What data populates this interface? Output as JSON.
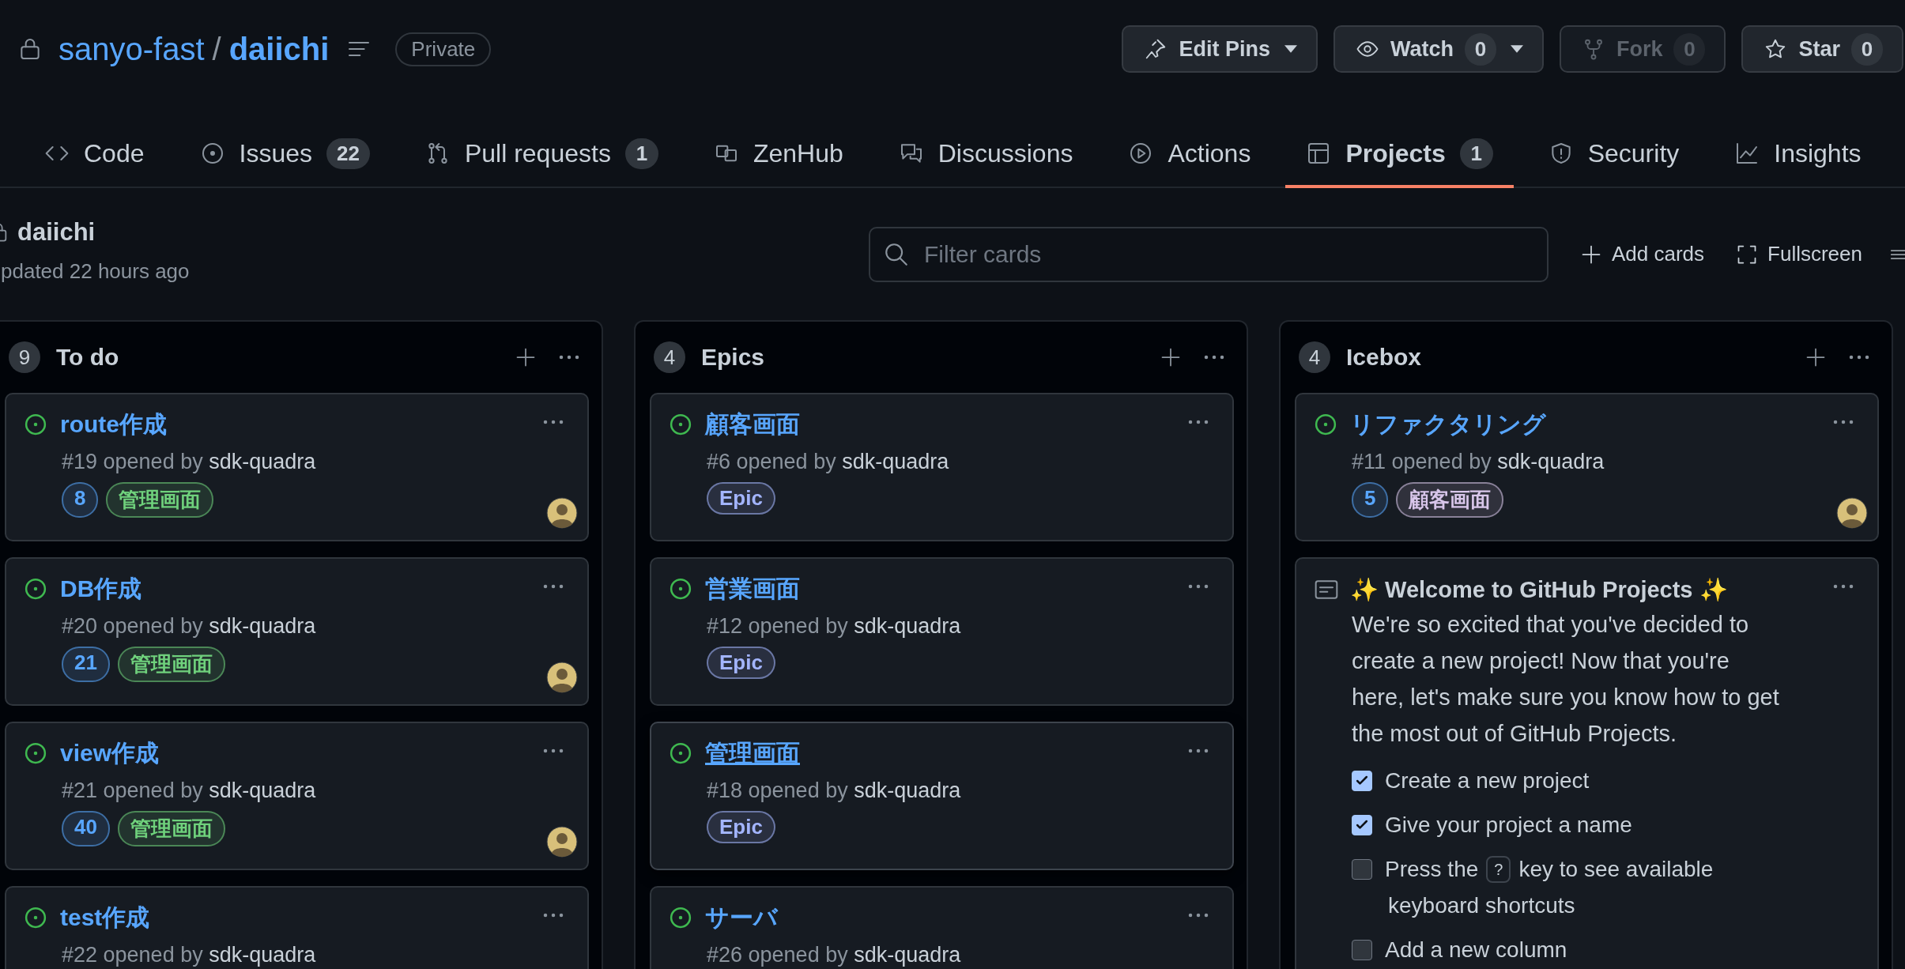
{
  "repo": {
    "owner": "sanyo-fast",
    "separator": "/",
    "name": "daiichi",
    "visibility": "Private"
  },
  "repo_actions": [
    {
      "kind": "pin",
      "label": "Edit Pins",
      "dropdown": true,
      "disabled": false
    },
    {
      "kind": "eye",
      "label": "Watch",
      "count": "0",
      "dropdown": true,
      "disabled": false
    },
    {
      "kind": "fork",
      "label": "Fork",
      "count": "0",
      "dropdown": false,
      "disabled": true
    },
    {
      "kind": "star",
      "label": "Star",
      "count": "0",
      "dropdown": false,
      "disabled": false
    }
  ],
  "tabs": [
    {
      "kind": "code",
      "label": "Code",
      "selected": false
    },
    {
      "kind": "issues",
      "label": "Issues",
      "count": "22",
      "selected": false
    },
    {
      "kind": "pulls",
      "label": "Pull requests",
      "count": "1",
      "selected": false
    },
    {
      "kind": "zenhub",
      "label": "ZenHub",
      "selected": false
    },
    {
      "kind": "discussions",
      "label": "Discussions",
      "selected": false
    },
    {
      "kind": "actions",
      "label": "Actions",
      "selected": false
    },
    {
      "kind": "projects",
      "label": "Projects",
      "count": "1",
      "selected": true
    },
    {
      "kind": "security",
      "label": "Security",
      "selected": false
    },
    {
      "kind": "insights",
      "label": "Insights",
      "selected": false
    }
  ],
  "project": {
    "title": "daiichi",
    "updated": "pdated 22 hours ago"
  },
  "filter": {
    "placeholder": "Filter cards"
  },
  "toolbar": [
    {
      "kind": "add",
      "label": "Add cards"
    },
    {
      "kind": "fullscreen",
      "label": "Fullscreen"
    },
    {
      "kind": "menu"
    }
  ],
  "columns": [
    {
      "count": "9",
      "name": "To do",
      "cards": [
        {
          "kind": "issue",
          "title": "route作成",
          "number": "#19",
          "opened": "opened by",
          "author": "sdk-quadra",
          "hovered": false,
          "assigned": true,
          "labels": [
            {
              "text": "8",
              "color": "#58a6ff"
            },
            {
              "text": "管理画面",
              "color": "#6fd17c"
            }
          ]
        },
        {
          "kind": "issue",
          "title": "DB作成",
          "number": "#20",
          "opened": "opened by",
          "author": "sdk-quadra",
          "hovered": false,
          "assigned": true,
          "labels": [
            {
              "text": "21",
              "color": "#58a6ff"
            },
            {
              "text": "管理画面",
              "color": "#6fd17c"
            }
          ]
        },
        {
          "kind": "issue",
          "title": "view作成",
          "number": "#21",
          "opened": "opened by",
          "author": "sdk-quadra",
          "hovered": false,
          "assigned": true,
          "labels": [
            {
              "text": "40",
              "color": "#58a6ff"
            },
            {
              "text": "管理画面",
              "color": "#6fd17c"
            }
          ]
        },
        {
          "kind": "issue",
          "title": "test作成",
          "number": "#22",
          "opened": "opened by",
          "author": "sdk-quadra",
          "hovered": false,
          "assigned": false
        }
      ]
    },
    {
      "count": "4",
      "name": "Epics",
      "cards": [
        {
          "kind": "issue",
          "title": "顧客画面",
          "number": "#6",
          "opened": "opened by",
          "author": "sdk-quadra",
          "hovered": false,
          "assigned": false,
          "labels": [
            {
              "text": "Epic",
              "color": "#a3b5ff"
            }
          ]
        },
        {
          "kind": "issue",
          "title": "営業画面",
          "number": "#12",
          "opened": "opened by",
          "author": "sdk-quadra",
          "hovered": false,
          "assigned": false,
          "labels": [
            {
              "text": "Epic",
              "color": "#a3b5ff"
            }
          ]
        },
        {
          "kind": "issue",
          "title": "管理画面",
          "number": "#18",
          "opened": "opened by",
          "author": "sdk-quadra",
          "hovered": true,
          "assigned": false,
          "labels": [
            {
              "text": "Epic",
              "color": "#a3b5ff"
            }
          ]
        },
        {
          "kind": "issue",
          "title": "サーバ",
          "number": "#26",
          "opened": "opened by",
          "author": "sdk-quadra",
          "hovered": false,
          "assigned": false
        }
      ]
    },
    {
      "count": "4",
      "name": "Icebox",
      "cards": [
        {
          "kind": "issue",
          "title": "リファクタリング",
          "number": "#11",
          "opened": "opened by",
          "author": "sdk-quadra",
          "hovered": false,
          "assigned": true,
          "labels": [
            {
              "text": "5",
              "color": "#58a6ff"
            },
            {
              "text": "顧客画面",
              "color": "#d8c6ea"
            }
          ]
        },
        {
          "kind": "note",
          "title": "✨ Welcome to GitHub Projects ✨",
          "body": "We're so excited that you've decided to create a new project! Now that you're here, let's make sure you know how to get the most out of GitHub Projects.",
          "checklist": [
            {
              "text": "Create a new project",
              "checked": true
            },
            {
              "text": "Give your project a name",
              "checked": true
            },
            {
              "text": "Press the",
              "key": "?",
              "text_after": "key to see available",
              "text_line2": "keyboard shortcuts",
              "checked": false
            },
            {
              "text": "Add a new column",
              "checked": false
            }
          ]
        }
      ]
    }
  ]
}
